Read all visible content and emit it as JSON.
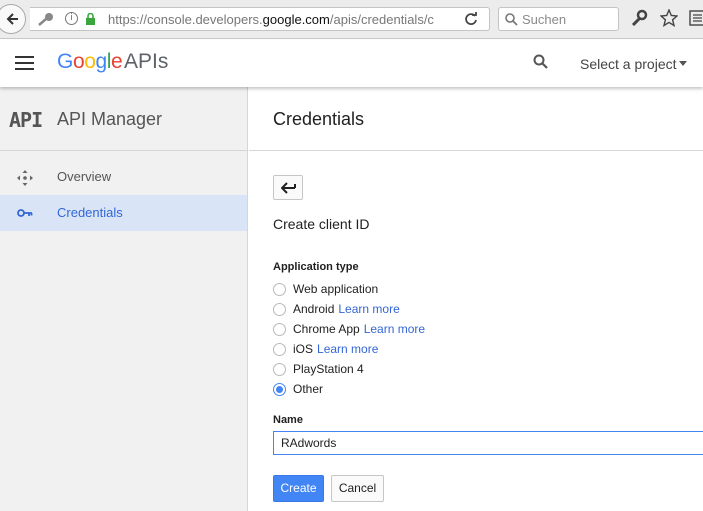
{
  "browser": {
    "url_prefix": "https://console.developers.",
    "url_host": "google.com",
    "url_suffix": "/apis/credentials/c",
    "search_placeholder": "Suchen"
  },
  "header": {
    "logo_letters": [
      "G",
      "o",
      "o",
      "g",
      "l",
      "e"
    ],
    "product": "APIs",
    "project_select": "Select a project"
  },
  "sidebar": {
    "mark": "API",
    "title": "API Manager",
    "items": [
      {
        "label": "Overview",
        "icon": "overview-icon"
      },
      {
        "label": "Credentials",
        "icon": "key-icon",
        "active": true
      }
    ]
  },
  "main": {
    "title": "Credentials",
    "section_title": "Create client ID",
    "app_type_label": "Application type",
    "options": [
      {
        "label": "Web application",
        "learn_more": "",
        "checked": false
      },
      {
        "label": "Android",
        "learn_more": "Learn more",
        "checked": false
      },
      {
        "label": "Chrome App",
        "learn_more": "Learn more",
        "checked": false
      },
      {
        "label": "iOS",
        "learn_more": "Learn more",
        "checked": false
      },
      {
        "label": "PlayStation 4",
        "learn_more": "",
        "checked": false
      },
      {
        "label": "Other",
        "learn_more": "",
        "checked": true
      }
    ],
    "name_label": "Name",
    "name_value": "RAdwords",
    "create_label": "Create",
    "cancel_label": "Cancel"
  },
  "colors": {
    "accent": "#4285f4",
    "link": "#3367d6",
    "active_nav_bg": "#d9e5f7"
  }
}
